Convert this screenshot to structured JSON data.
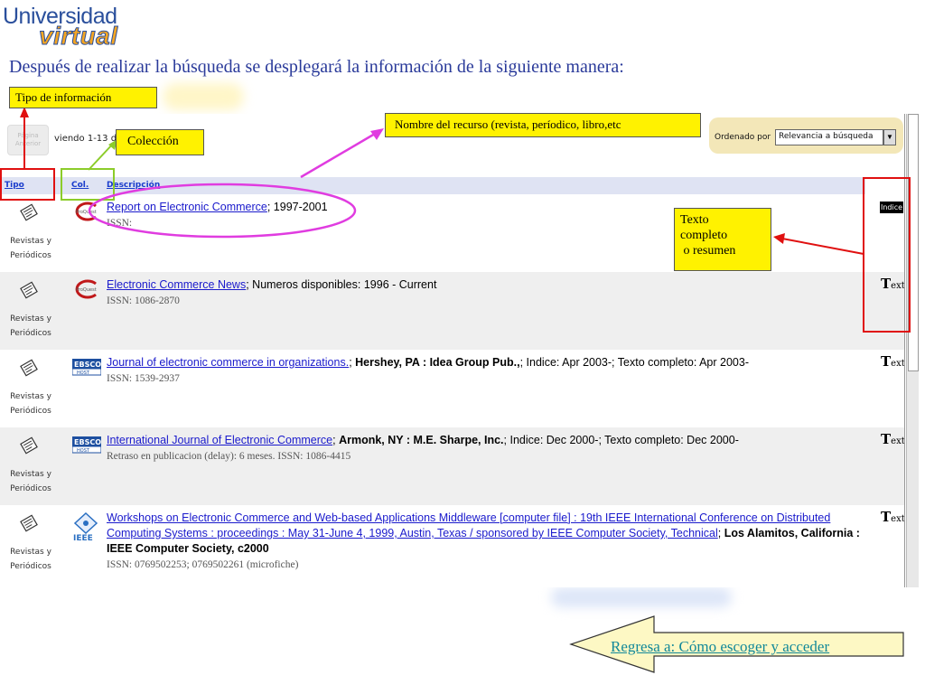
{
  "logo": {
    "line1": "Universidad",
    "line2": "virtual"
  },
  "heading": "Después de realizar la búsqueda se desplegará la información de la siguiente manera:",
  "callouts": {
    "tipo": "Tipo de información",
    "coleccion": "Colección",
    "nombre": "Nombre del recurso (revista, períodico, libro,etc",
    "texto": [
      "Texto",
      "completo",
      " o resumen"
    ]
  },
  "screenshot": {
    "prev_button": "Página Anterior",
    "viendo": "viendo 1-13 de",
    "sort_label": "Ordenado por",
    "sort_value": "Relevancia a búsqueda",
    "columns": {
      "tipo": "Tipo",
      "col": "Col.",
      "desc": "Descripción"
    },
    "type_label_1": "Revistas y",
    "type_label_2": "Periódicos",
    "rows": [
      {
        "title": "Report on Electronic Commerce",
        "rest": "; 1997-2001",
        "publisher": "",
        "tail": "",
        "issn": "ISSN:",
        "source": "proquest",
        "indicator": "Indice"
      },
      {
        "title": "Electronic Commerce News",
        "rest": "; Numeros disponibles: 1996 - Current",
        "publisher": "",
        "tail": "",
        "issn": "ISSN: 1086-2870",
        "source": "proquest",
        "indicator": "Text"
      },
      {
        "title": "Journal of electronic commerce in organizations.",
        "rest": "; ",
        "publisher": "Hershey, PA : Idea Group Pub.,",
        "tail": "; Indice: Apr 2003-; Texto completo: Apr 2003-",
        "issn": "ISSN: 1539-2937",
        "source": "ebsco",
        "indicator": "Text"
      },
      {
        "title": "International Journal of Electronic Commerce",
        "rest": "; ",
        "publisher": "Armonk, NY : M.E. Sharpe, Inc.",
        "tail": "; Indice: Dec 2000-; Texto completo: Dec 2000-",
        "issn": "Retraso en publicacion (delay): 6 meses. ISSN: 1086-4415",
        "source": "ebsco",
        "indicator": "Text"
      },
      {
        "title": "Workshops on Electronic Commerce and Web-based Applications Middleware [computer file] : 19th IEEE International Conference on Distributed Computing Systems : proceedings : May 31-June 4, 1999, Austin, Texas / sponsored by IEEE Computer Society, Technical",
        "rest": "; ",
        "publisher": "Los Alamitos, California : IEEE Computer Society, c2000",
        "tail": "",
        "issn": "ISSN: 0769502253; 0769502261 (microfiche)",
        "source": "ieee",
        "indicator": "Text"
      }
    ],
    "source_labels": {
      "proquest": "ProQuest",
      "ebsco": "EBSCO",
      "ebsco_sub": "HOST",
      "ieee": "IEEE"
    },
    "text_icon": {
      "big": "T",
      "small": "ext"
    }
  },
  "return_link": "Regresa a: Cómo escoger y acceder"
}
